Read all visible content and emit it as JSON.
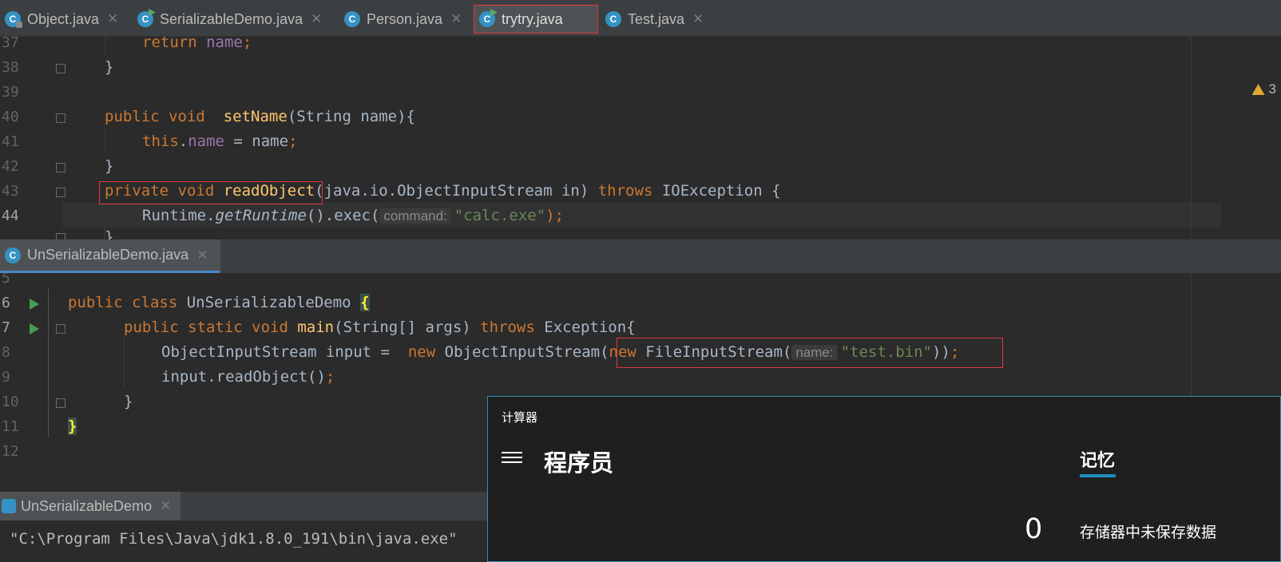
{
  "top_tabs": [
    {
      "label": "Object.java",
      "icon": "java-class-locked-icon"
    },
    {
      "label": "SerializableDemo.java",
      "icon": "java-class-runnable-icon"
    },
    {
      "label": "Person.java",
      "icon": "java-class-icon"
    },
    {
      "label": "trytry.java",
      "icon": "java-class-runnable-icon",
      "active": true
    },
    {
      "label": "Test.java",
      "icon": "java-class-icon"
    }
  ],
  "warnings_count": "3",
  "editor1": {
    "line_numbers": [
      "37",
      "38",
      "39",
      "40",
      "41",
      "42",
      "43",
      "44"
    ],
    "lines": {
      "l37_kw": "return",
      "l37_fld": "name",
      "l37_end": ";",
      "l38": "}",
      "l40_kw": "public void",
      "l40_fn": "setName",
      "l40_rest": "(String name){",
      "l41_kw": "this",
      "l41_dot": ".",
      "l41_fld": "name",
      "l41_rest": " = name",
      "l41_end": ";",
      "l42": "}",
      "l43_kw": "private void",
      "l43_fn": "readObject",
      "l43_rest": "(java.io.ObjectInputStream in) ",
      "l43_kw2": "throws",
      "l43_rest2": " IOException {",
      "l44_a": "Runtime.",
      "l44_b": "getRuntime",
      "l44_c": "().exec(",
      "l44_hint": "command:",
      "l44_str": "\"calc.exe\"",
      "l44_end": ");",
      "l45": "}"
    }
  },
  "editor2": {
    "tab_label": "UnSerializableDemo.java",
    "line_numbers": [
      "5",
      "6",
      "7",
      "8",
      "9",
      "10",
      "11",
      "12"
    ],
    "lines": {
      "l6_kw": "public class",
      "l6_name": " UnSerializableDemo ",
      "l6_brace": "{",
      "l7_kw": "public static void",
      "l7_fn": "main",
      "l7_rest": "(String[] args) ",
      "l7_kw2": "throws",
      "l7_rest2": " Exception{",
      "l8_a": "ObjectInputStream input =  ",
      "l8_kw": "new",
      "l8_b": " ObjectInputStream(",
      "l8_kw2": "new",
      "l8_c": " FileInputStream(",
      "l8_hint": "name:",
      "l8_str": "\"test.bin\"",
      "l8_d": "))",
      "l8_end": ";",
      "l9_a": "input.readObject()",
      "l9_end": ";",
      "l10": "}",
      "l11": "}"
    }
  },
  "run_panel": {
    "tab_label": "UnSerializableDemo",
    "output": "\"C:\\Program Files\\Java\\jdk1.8.0_191\\bin\\java.exe\""
  },
  "calculator": {
    "title": "计算器",
    "mode": "程序员",
    "memory_tab": "记忆",
    "display": "0",
    "memory_message": "存储器中未保存数据"
  }
}
